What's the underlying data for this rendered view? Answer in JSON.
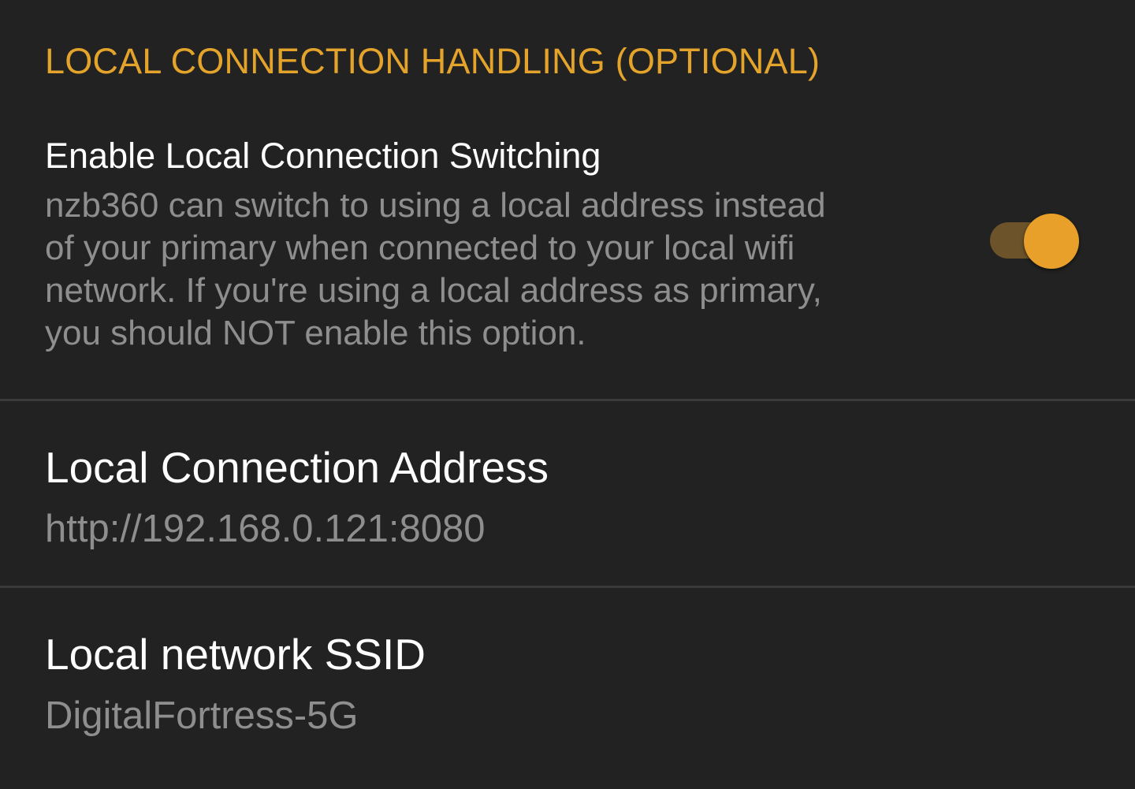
{
  "section": {
    "header": "LOCAL CONNECTION HANDLING (OPTIONAL)"
  },
  "enable_switching": {
    "title": "Enable Local Connection Switching",
    "summary_lines": [
      "nzb360 can switch to using a local address instead",
      "of your primary when connected to your local wifi",
      "network.  If you're using a local address as primary,",
      "you should NOT enable this option."
    ],
    "toggle_on": true
  },
  "local_address": {
    "title": "Local Connection Address",
    "value": "http://192.168.0.121:8080"
  },
  "local_ssid": {
    "title": "Local network SSID",
    "value": "DigitalFortress-5G"
  },
  "colors": {
    "background": "#222222",
    "accent": "#e4a42b",
    "title_text": "#ffffff",
    "summary_text": "#8e8e8e",
    "divider": "#3a3a3a",
    "toggle_track_on": "#6d5329",
    "toggle_thumb_on": "#e8a02a"
  }
}
